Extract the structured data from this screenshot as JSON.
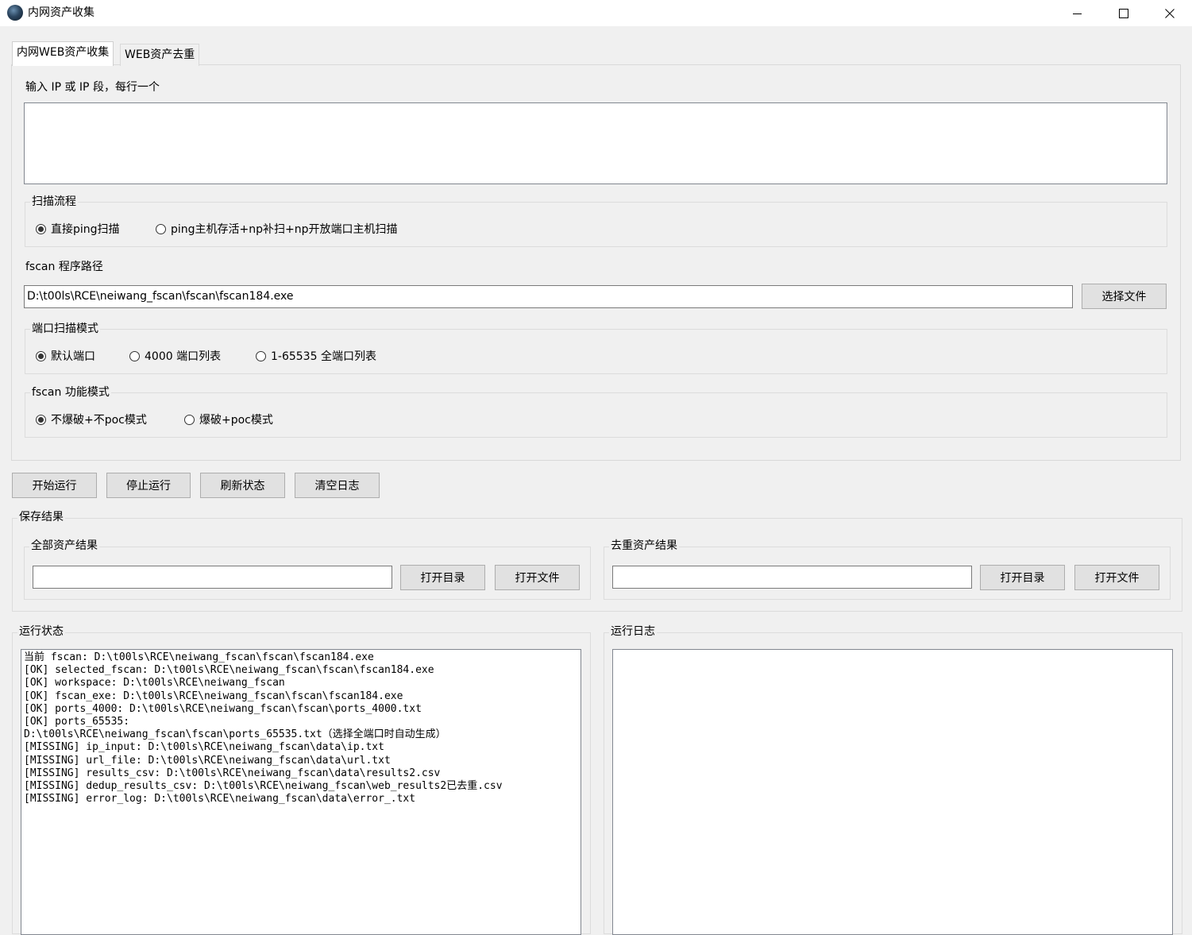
{
  "window": {
    "title": "内网资产收集"
  },
  "tabs": [
    {
      "label": "内网WEB资产收集"
    },
    {
      "label": "WEB资产去重"
    }
  ],
  "ip_input": {
    "label": "输入 IP 或 IP 段，每行一个",
    "value": ""
  },
  "scan_flow": {
    "title": "扫描流程",
    "options": [
      {
        "label": "直接ping扫描",
        "selected": true
      },
      {
        "label": "ping主机存活+np补扫+np开放端口主机扫描",
        "selected": false
      }
    ]
  },
  "fscan_path": {
    "label": "fscan 程序路径",
    "value": "D:\\t00ls\\RCE\\neiwang_fscan\\fscan\\fscan184.exe",
    "browse_label": "选择文件"
  },
  "port_mode": {
    "title": "端口扫描模式",
    "options": [
      {
        "label": "默认端口",
        "selected": true
      },
      {
        "label": "4000 端口列表",
        "selected": false
      },
      {
        "label": "1-65535 全端口列表",
        "selected": false
      }
    ]
  },
  "func_mode": {
    "title": "fscan 功能模式",
    "options": [
      {
        "label": "不爆破+不poc模式",
        "selected": true
      },
      {
        "label": "爆破+poc模式",
        "selected": false
      }
    ]
  },
  "actions": {
    "start": "开始运行",
    "stop": "停止运行",
    "refresh": "刷新状态",
    "clear": "清空日志"
  },
  "save_results": {
    "title": "保存结果",
    "all": {
      "title": "全部资产结果",
      "value": "",
      "open_dir": "打开目录",
      "open_file": "打开文件"
    },
    "dedup": {
      "title": "去重资产结果",
      "value": "",
      "open_dir": "打开目录",
      "open_file": "打开文件"
    }
  },
  "status": {
    "title": "运行状态",
    "text": "当前 fscan: D:\\t00ls\\RCE\\neiwang_fscan\\fscan\\fscan184.exe\n[OK] selected_fscan: D:\\t00ls\\RCE\\neiwang_fscan\\fscan\\fscan184.exe\n[OK] workspace: D:\\t00ls\\RCE\\neiwang_fscan\n[OK] fscan_exe: D:\\t00ls\\RCE\\neiwang_fscan\\fscan\\fscan184.exe\n[OK] ports_4000: D:\\t00ls\\RCE\\neiwang_fscan\\fscan\\ports_4000.txt\n[OK] ports_65535:\nD:\\t00ls\\RCE\\neiwang_fscan\\fscan\\ports_65535.txt（选择全端口时自动生成）\n[MISSING] ip_input: D:\\t00ls\\RCE\\neiwang_fscan\\data\\ip.txt\n[MISSING] url_file: D:\\t00ls\\RCE\\neiwang_fscan\\data\\url.txt\n[MISSING] results_csv: D:\\t00ls\\RCE\\neiwang_fscan\\data\\results2.csv\n[MISSING] dedup_results_csv: D:\\t00ls\\RCE\\neiwang_fscan\\web_results2已去重.csv\n[MISSING] error_log: D:\\t00ls\\RCE\\neiwang_fscan\\data\\error_.txt"
  },
  "log": {
    "title": "运行日志",
    "text": ""
  }
}
